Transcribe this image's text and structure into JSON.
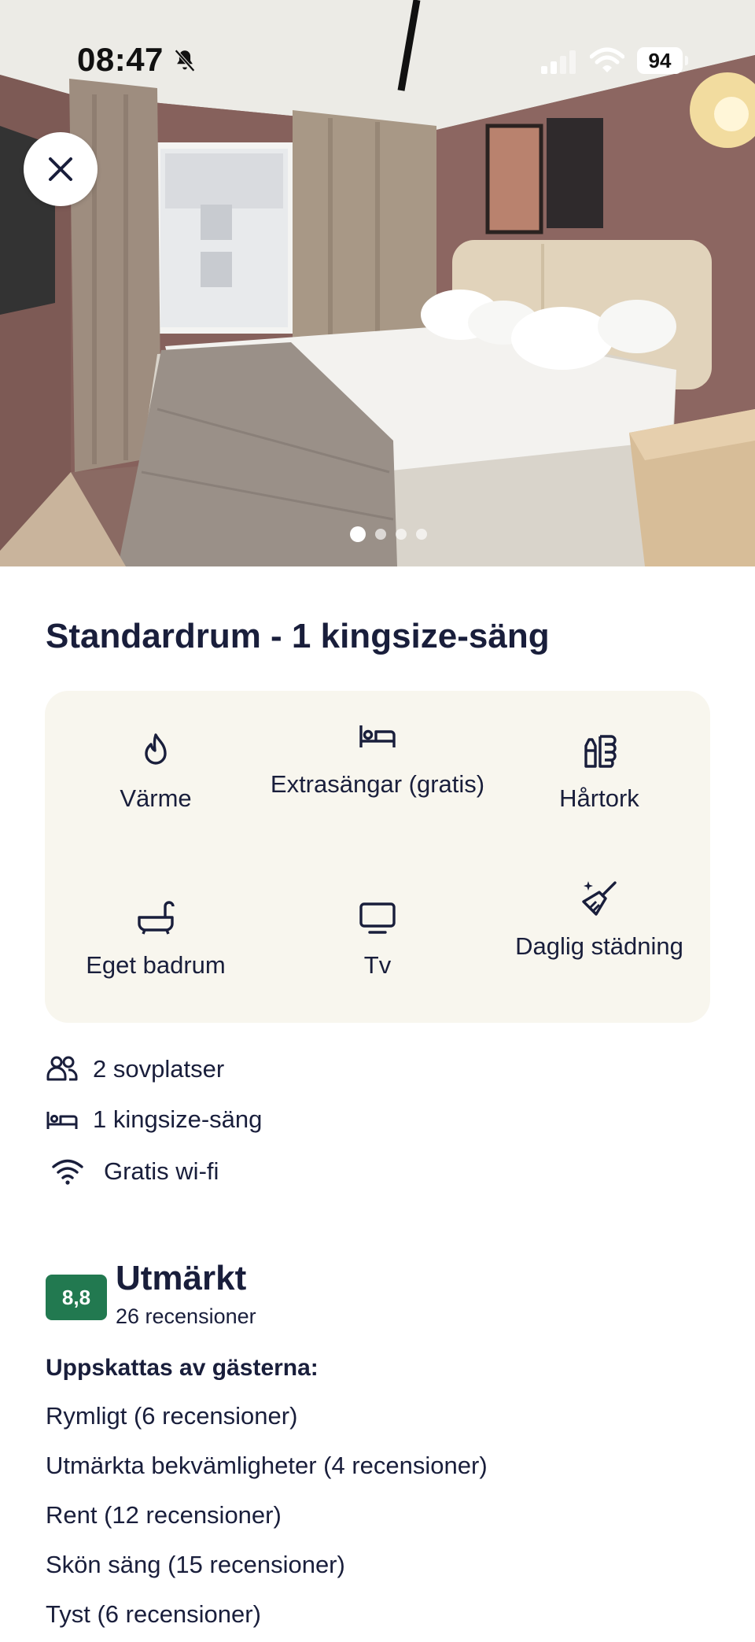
{
  "status_bar": {
    "time": "08:47",
    "battery": "94"
  },
  "gallery": {
    "image_count": 4,
    "active_index": 0
  },
  "room": {
    "title": "Standardrum - 1 kingsize-säng"
  },
  "amenities": [
    {
      "label": "Värme",
      "icon": "fire-icon"
    },
    {
      "label": "Extrasängar (gratis)",
      "icon": "bed-icon"
    },
    {
      "label": "Hårtork",
      "icon": "hair-dryer-icon"
    },
    {
      "label": "Eget badrum",
      "icon": "bathtub-icon"
    },
    {
      "label": "Tv",
      "icon": "tv-icon"
    },
    {
      "label": "Daglig städning",
      "icon": "cleaning-icon"
    }
  ],
  "features": [
    {
      "label": "2 sovplatser",
      "icon": "people-icon"
    },
    {
      "label": "1 kingsize-säng",
      "icon": "bed-icon"
    },
    {
      "label": "Gratis wi-fi",
      "icon": "wifi-icon"
    }
  ],
  "rating": {
    "score": "8,8",
    "label": "Utmärkt",
    "count": "26 recensioner",
    "badge_color": "#227950"
  },
  "appreciated": {
    "heading": "Uppskattas av gästerna:",
    "items": [
      "Rymligt (6 recensioner)",
      "Utmärkta bekvämligheter (4 recensioner)",
      "Rent (12 recensioner)",
      "Skön säng (15 recensioner)",
      "Tyst (6 recensioner)"
    ]
  }
}
